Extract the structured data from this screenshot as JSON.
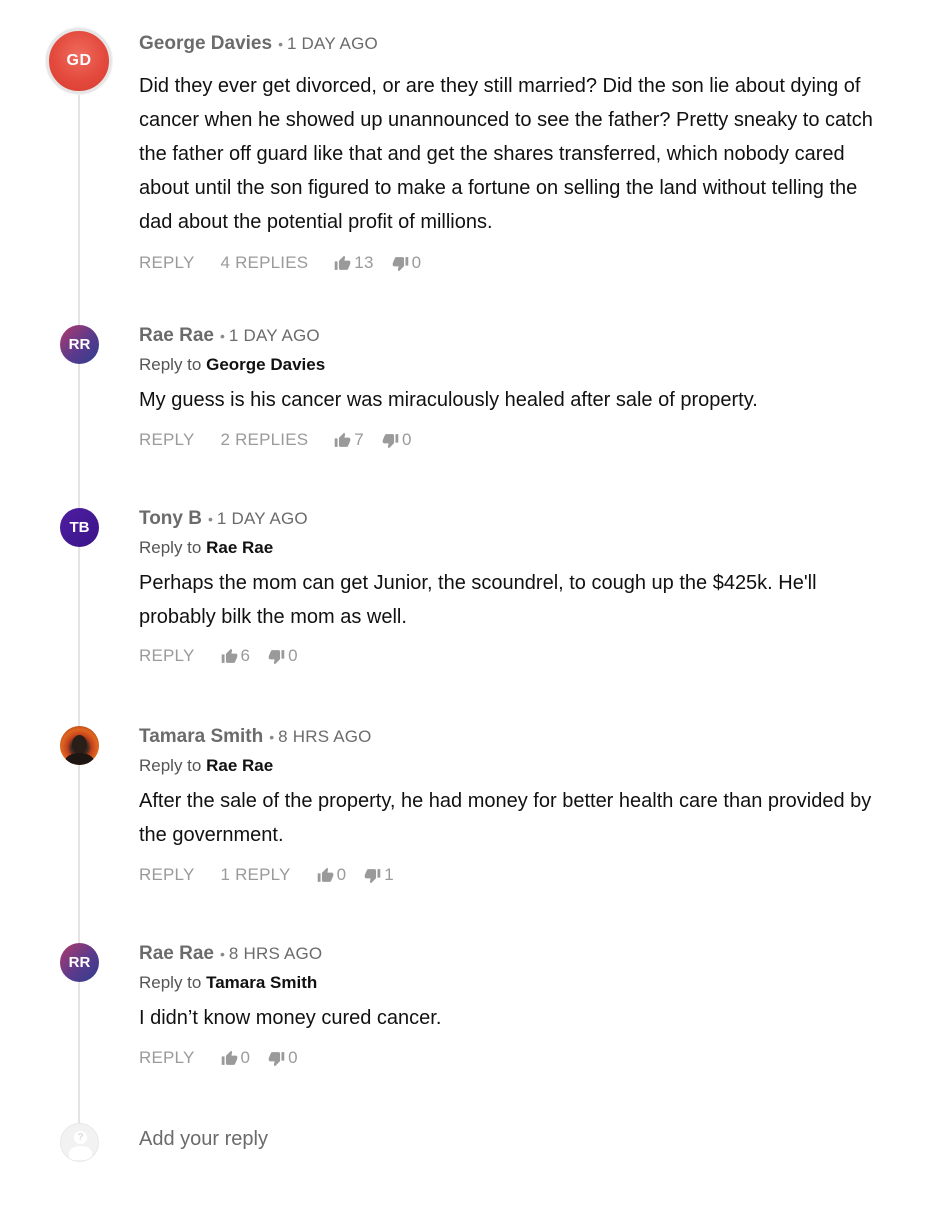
{
  "comments": [
    {
      "initials": "GD",
      "author": "George Davies",
      "time": "1 DAY AGO",
      "body": "Did they ever get divorced, or are they still married? Did the son lie about dying of cancer when he showed up unannounced to see the father? Pretty sneaky to catch the father off guard like that and get the shares transferred, which nobody cared about until the son figured to make a fortune on selling the land without telling the dad about the potential profit of millions.",
      "reply_label": "REPLY",
      "replies_label": "4 REPLIES",
      "likes": "13",
      "dislikes": "0",
      "avatar_color": "#e34a3d"
    },
    {
      "initials": "RR",
      "author": "Rae Rae",
      "time": "1 DAY AGO",
      "reply_to_prefix": "Reply to",
      "reply_to": "George Davies",
      "body": "My guess is his cancer was miraculously healed after sale of property.",
      "reply_label": "REPLY",
      "replies_label": "2 REPLIES",
      "likes": "7",
      "dislikes": "0"
    },
    {
      "initials": "TB",
      "author": "Tony B",
      "time": "1 DAY AGO",
      "reply_to_prefix": "Reply to",
      "reply_to": "Rae Rae",
      "body": "Perhaps the mom can get Junior, the scoundrel, to cough up the $425k. He'll probably bilk the mom as well.",
      "reply_label": "REPLY",
      "likes": "6",
      "dislikes": "0"
    },
    {
      "author": "Tamara Smith",
      "time": "8 HRS AGO",
      "reply_to_prefix": "Reply to",
      "reply_to": "Rae Rae",
      "body": "After the sale of the property, he had money for better health care than provided by the government.",
      "reply_label": "REPLY",
      "replies_label": "1 REPLY",
      "likes": "0",
      "dislikes": "1"
    },
    {
      "initials": "RR",
      "author": "Rae Rae",
      "time": "8 HRS AGO",
      "reply_to_prefix": "Reply to",
      "reply_to": "Tamara Smith",
      "body": "I didn’t know money cured cancer.",
      "reply_label": "REPLY",
      "likes": "0",
      "dislikes": "0"
    }
  ],
  "add_reply": {
    "placeholder": "Add your reply",
    "guest_icon": "?"
  },
  "icons": {
    "like": "thumbs-up-icon",
    "dislike": "thumbs-down-icon"
  },
  "colors": {
    "action_gray": "#9a9a9a",
    "author_gray": "#6b6b6b",
    "text": "#111111"
  }
}
